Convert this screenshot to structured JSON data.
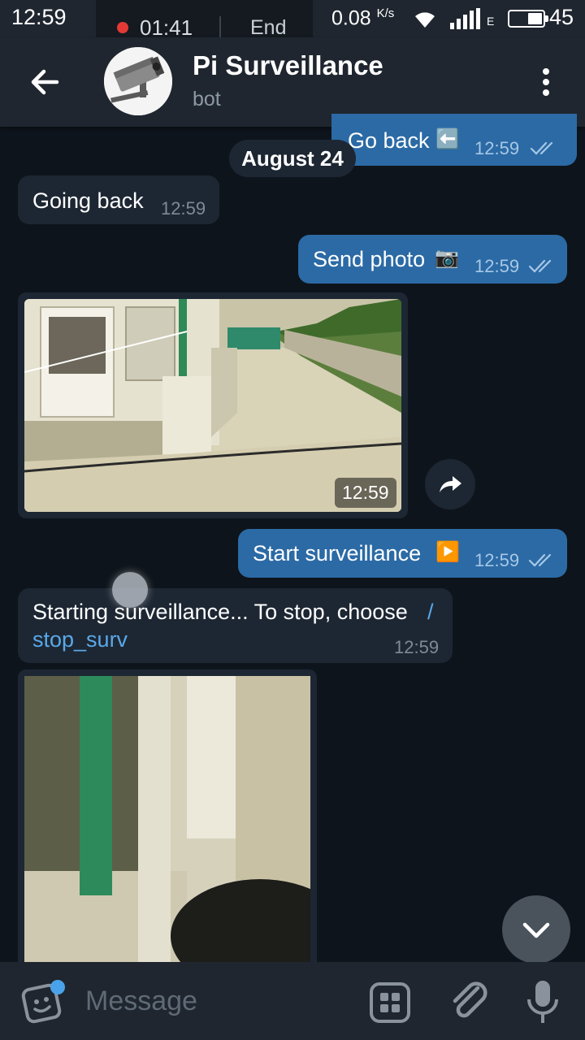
{
  "status_bar": {
    "time": "12:59",
    "call_duration": "01:41",
    "call_end_label": "End",
    "net_speed": "0.08",
    "net_speed_unit": "K/s",
    "network_type": "E",
    "battery_level": "45",
    "battery_fraction": 0.45
  },
  "header": {
    "title": "Pi Surveillance",
    "subtitle": "bot",
    "avatar_icon": "cctv-camera-icon"
  },
  "messages": {
    "m1": {
      "text": "Go back",
      "emoji": "⬅️",
      "time": "12:59",
      "direction": "outgoing"
    },
    "date_separator": "August 24",
    "m2": {
      "text": "Going back",
      "time": "12:59",
      "direction": "incoming"
    },
    "m3": {
      "text": "Send photo",
      "emoji": "📷",
      "time": "12:59",
      "direction": "outgoing"
    },
    "m4": {
      "type": "photo",
      "time": "12:59",
      "direction": "incoming"
    },
    "m5": {
      "text": "Start surveillance",
      "emoji": "▶️",
      "time": "12:59",
      "direction": "outgoing"
    },
    "m6": {
      "text": "Starting surveillance... To stop, choose ",
      "link": "/stop_surv",
      "link_part1": "/",
      "link_part2": "stop_surv",
      "time": "12:59",
      "direction": "incoming"
    },
    "m7": {
      "type": "photo",
      "direction": "incoming"
    }
  },
  "input": {
    "placeholder": "Message"
  },
  "colors": {
    "background": "#0e141b",
    "bar": "#1f262f",
    "outgoing_bubble": "#2b6aa5",
    "incoming_bubble": "#1d2733",
    "link": "#5aa8e8",
    "badge": "#4aa3ea"
  }
}
